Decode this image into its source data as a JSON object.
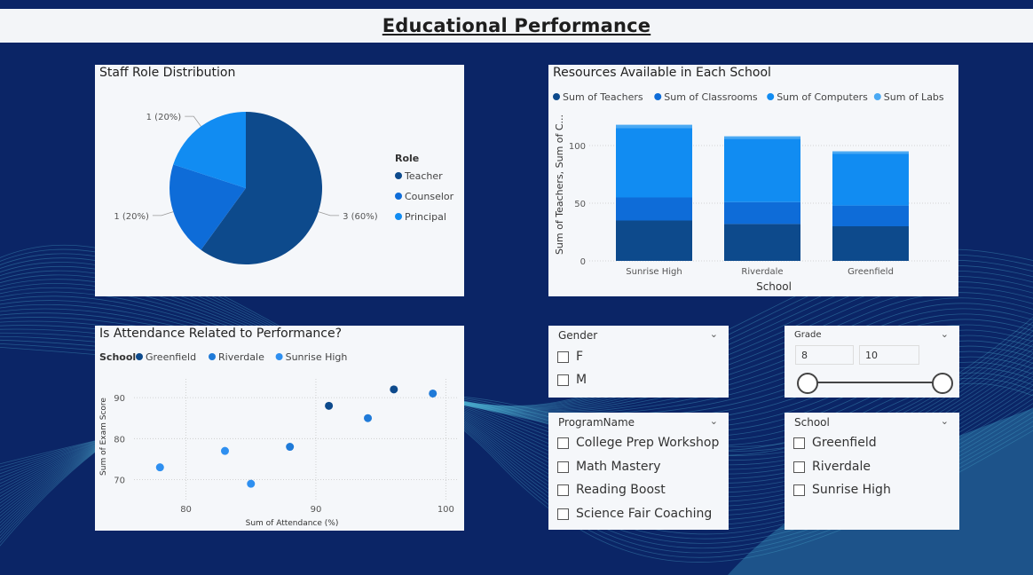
{
  "header": {
    "title": "Educational Performance "
  },
  "staff_chart": {
    "title": "Staff Role Distribution",
    "legend_title": "Role",
    "chart_data": {
      "type": "pie",
      "categories": [
        "Teacher",
        "Counselor",
        "Principal"
      ],
      "values": [
        3,
        1,
        1
      ],
      "labels": [
        "3 (60%)",
        "1 (20%)",
        "1 (20%)"
      ],
      "colors": [
        "#0d4a8c",
        "#0e6cd8",
        "#118cf2"
      ]
    }
  },
  "resources_chart": {
    "title": "Resources Available in Each School",
    "chart_data": {
      "type": "bar",
      "stacked": true,
      "categories": [
        "Sunrise High",
        "Riverdale",
        "Greenfield"
      ],
      "series": [
        {
          "name": "Sum of Teachers",
          "values": [
            35,
            32,
            30
          ],
          "color": "#0d4a8c"
        },
        {
          "name": "Sum of Classrooms",
          "values": [
            20,
            19,
            18
          ],
          "color": "#0e6cd8"
        },
        {
          "name": "Sum of Computers",
          "values": [
            60,
            55,
            45
          ],
          "color": "#118cf2"
        },
        {
          "name": "Sum of Labs",
          "values": [
            3,
            2,
            2
          ],
          "color": "#4aa9f3"
        }
      ],
      "xlabel": "School",
      "ylabel": "Sum of Teachers, Sum of C...",
      "yticks": [
        0,
        50,
        100
      ],
      "ylim": [
        0,
        130
      ]
    }
  },
  "attendance_chart": {
    "title": "Is Attendance Related to Performance?",
    "legend_title": "School",
    "chart_data": {
      "type": "scatter",
      "series": [
        {
          "name": "Greenfield",
          "color": "#0d4a8c",
          "points": [
            [
              91,
              88
            ],
            [
              96,
              92
            ]
          ]
        },
        {
          "name": "Riverdale",
          "color": "#1f7ad8",
          "points": [
            [
              88,
              78
            ],
            [
              94,
              85
            ],
            [
              99,
              91
            ]
          ]
        },
        {
          "name": "Sunrise High",
          "color": "#2e8ff0",
          "points": [
            [
              78,
              73
            ],
            [
              83,
              77
            ],
            [
              85,
              69
            ]
          ]
        }
      ],
      "xlabel": "Sum of Attendance (%)",
      "ylabel": "Sum of Exam Score",
      "xticks": [
        80,
        90,
        100
      ],
      "yticks": [
        70,
        80,
        90
      ],
      "xlim": [
        76,
        101
      ],
      "ylim": [
        66,
        95
      ]
    }
  },
  "gender_slicer": {
    "title": "Gender",
    "options": [
      "F",
      "M"
    ]
  },
  "grade_slicer": {
    "title": "Grade",
    "min": "8",
    "max": "10"
  },
  "program_slicer": {
    "title": "ProgramName",
    "options": [
      "College Prep Workshop",
      "Math Mastery",
      "Reading Boost",
      "Science Fair Coaching"
    ]
  },
  "school_slicer": {
    "title": "School",
    "options": [
      "Greenfield",
      "Riverdale",
      "Sunrise High"
    ]
  }
}
